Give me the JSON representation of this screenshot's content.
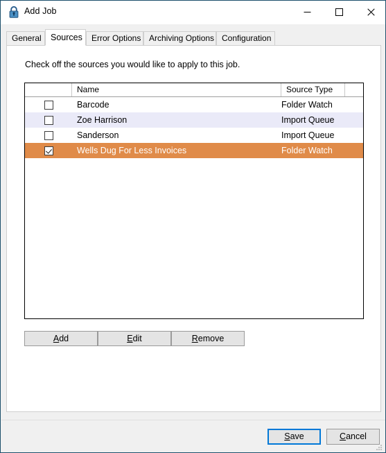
{
  "window": {
    "title": "Add Job",
    "icon": "lock-icon",
    "controls": {
      "minimize": "minimize-icon",
      "maximize": "maximize-icon",
      "close": "close-icon"
    },
    "border_color": "#1c4f6b"
  },
  "tabs": [
    {
      "label": "General",
      "active": false
    },
    {
      "label": "Sources",
      "active": true
    },
    {
      "label": "Error Options",
      "active": false
    },
    {
      "label": "Archiving Options",
      "active": false
    },
    {
      "label": "Configuration",
      "active": false
    }
  ],
  "page": {
    "instructions": "Check off the sources you would like to apply to this job."
  },
  "listview": {
    "columns": [
      {
        "label": "",
        "key": "check"
      },
      {
        "label": "Name",
        "key": "name"
      },
      {
        "label": "Source Type",
        "key": "type"
      },
      {
        "label": "",
        "key": "tail"
      }
    ],
    "rows": [
      {
        "checked": false,
        "name": "Barcode",
        "type": "Folder Watch",
        "selected": false,
        "alt": false
      },
      {
        "checked": false,
        "name": "Zoe Harrison",
        "type": "Import Queue",
        "selected": false,
        "alt": true
      },
      {
        "checked": false,
        "name": "Sanderson",
        "type": "Import Queue",
        "selected": false,
        "alt": false
      },
      {
        "checked": true,
        "name": "Wells Dug For Less Invoices",
        "type": "Folder Watch",
        "selected": true,
        "alt": false
      }
    ],
    "selection_color": "#e08b49",
    "alt_row_color": "#eaeaf8"
  },
  "actions": {
    "add": {
      "accel": "A",
      "rest": "dd"
    },
    "edit": {
      "accel": "E",
      "rest": "dit"
    },
    "remove": {
      "accel": "R",
      "rest": "emove"
    }
  },
  "footer": {
    "save": {
      "accel": "S",
      "rest": "ave",
      "focused": true
    },
    "cancel": {
      "accel": "C",
      "rest": "ancel",
      "focused": false
    },
    "focus_color": "#0078d7",
    "grip": "resize-grip-icon"
  }
}
